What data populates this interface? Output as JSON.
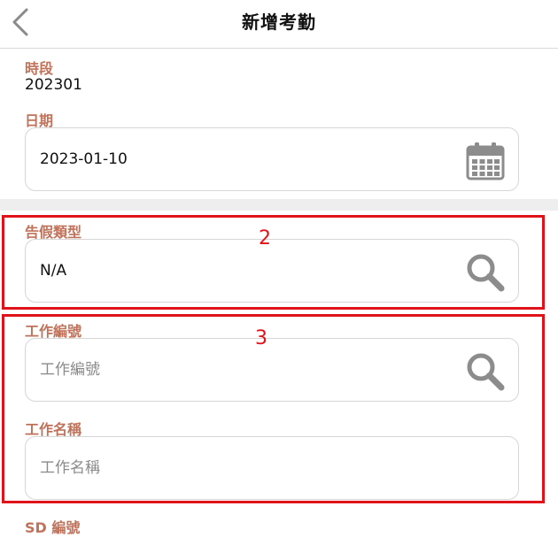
{
  "header": {
    "title": "新增考勤",
    "back_icon": "chevron-left-icon"
  },
  "form": {
    "period": {
      "label": "時段",
      "value": "202301"
    },
    "date": {
      "label": "日期",
      "value": "2023-01-10",
      "icon": "calendar-icon"
    },
    "leave_type": {
      "label": "告假類型",
      "value": "N/A",
      "icon": "search-icon"
    },
    "job_number": {
      "label": "工作編號",
      "placeholder": "工作編號",
      "icon": "search-icon"
    },
    "job_name": {
      "label": "工作名稱",
      "placeholder": "工作名稱"
    },
    "sd_number": {
      "label": "SD 編號"
    }
  },
  "annotations": {
    "box_2": "2",
    "box_3": "3",
    "color": "#e0131b"
  },
  "colors": {
    "label": "#c0735a",
    "icon": "#8c8c8c",
    "divider": "#eeeeee"
  }
}
